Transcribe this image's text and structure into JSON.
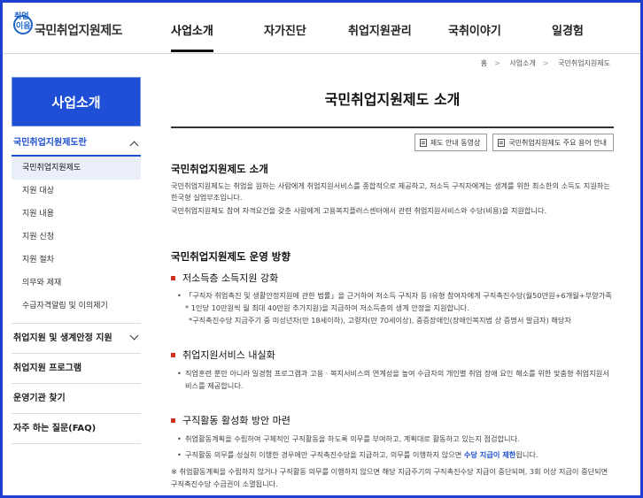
{
  "header": {
    "logo_line1": "취업",
    "logo_line2": "이음",
    "logo_text": "국민취업지원제도",
    "nav": [
      "사업소개",
      "자가진단",
      "취업지원관리",
      "국취이야기",
      "일경험"
    ]
  },
  "breadcrumb": [
    "홈",
    "사업소개",
    "국민취업지원제도"
  ],
  "sidebar": {
    "title": "사업소개",
    "open_group": "국민취업지원제도란",
    "sub_items": [
      "국민취업지원제도",
      "지원 대상",
      "지원 내용",
      "지원 신청",
      "지원 절차",
      "의무와 제재",
      "수급자격알림 및 이의제기"
    ],
    "groups": [
      "취업지원 및 생계안정 지원",
      "취업지원 프로그램",
      "운영기관 찾기",
      "자주 하는 질문(FAQ)"
    ]
  },
  "main": {
    "title": "국민취업지원제도 소개",
    "buttons": [
      "제도 안내 동영상",
      "국민취업지원제도 주요 용어 안내"
    ],
    "intro_heading": "국민취업지원제도 소개",
    "intro_p1": "국민취업지원제도는 취업을 원하는 사람에게 취업지원서비스를 종합적으로 제공하고, 저소득 구직자에게는 생계를 위한 최소한의 소득도 지원하는 한국형 실업부조입니다.",
    "intro_p2": "국민취업지원제도 참여 자격요건을 갖춘 사람에게 고용복지플러스센터에서 관련 취업지원서비스와 수당(비용)을 지원합니다.",
    "direction_heading": "국민취업지원제도 운영 방향",
    "d1_title": "저소득층 소득지원 강화",
    "d1_item1": "「구직자 취업촉진 및 생활안정지원에 관한 법률」을 근거하여 저소득 구직자 등 I유형 참여자에게 구직촉진수당(월50만원+6개월+부양가족* 1인당 10만원씩 월 최대 40만원 추가지원)을 지급하여 저소득층의 생계 안정을 지원합니다.",
    "d1_item2": "*구직촉진수당 지급주기 중 미성년자(만 18세이하), 고령자(만 70세이상), 중증장애인(장애인복지법 상 증명서 발급자) 해당자",
    "d2_title": "취업지원서비스 내실화",
    "d2_item1": "직업훈련 뿐만 아니라 일경험 프로그램과 고용 · 복지서비스의 연계성을 높여 수급자의 개인별 취업 장애 요인 해소를 위한 맞춤형 취업지원서비스를 제공합니다.",
    "d3_title": "구직활동 활성화 방안 마련",
    "d3_item1": "취업활동계획을 수립하여 구체적인 구직활동을 하도록 의무를 부여하고, 계획대로 활동하고 있는지 점검합니다.",
    "d3_item2_a": "구직활동 의무를 성실히 이행한 경우에만 구직촉진수당을 지급하고, 의무를 이행하지 않으면 ",
    "d3_item2_b": "수당 지급이 제한",
    "d3_item2_c": "됩니다.",
    "note": "※ 취업활동계획을 수립하지 않거나 구직활동 의무를 이행하지 않으면 해당 지급주기의 구직촉진수당 지급이 중단되며, 3회 이상 지급이 중단되면 구직촉진수당 수급권이 소멸됩니다."
  },
  "colors": {
    "frame": "#1f3fd0",
    "sidebar_title_bg": "#1f4fd6",
    "accent_blue": "#1d4fcf",
    "bullet_red": "#d3301f"
  }
}
